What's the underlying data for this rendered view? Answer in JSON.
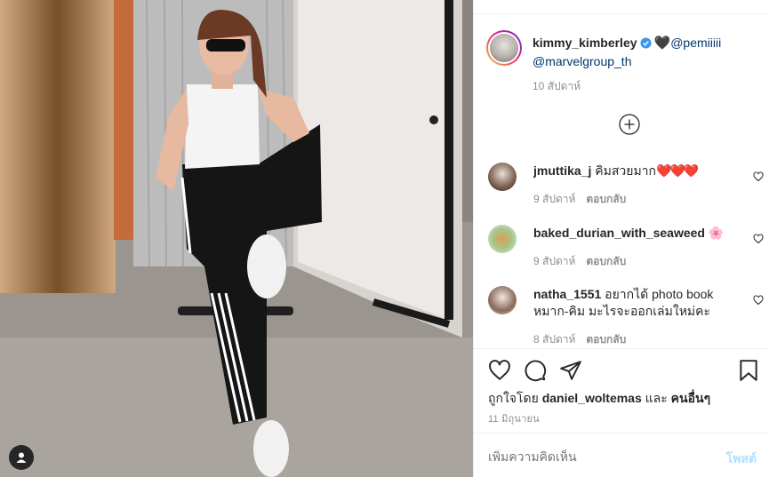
{
  "post": {
    "username": "kimmy_kimberley",
    "caption_emoji": "🖤",
    "mention_1": "@pemiiiii",
    "mention_2": "@marvelgroup_th",
    "time": "10 สัปดาห์"
  },
  "comments": [
    {
      "user": "jmuttika_j",
      "text": "คิมสวยมาก",
      "emoji": "❤️❤️❤️",
      "time": "9 สัปดาห์",
      "reply": "ตอบกลับ"
    },
    {
      "user": "baked_durian_with_seaweed",
      "text": "",
      "emoji": "🌸",
      "time": "9 สัปดาห์",
      "reply": "ตอบกลับ"
    },
    {
      "user": "natha_1551",
      "text": "อยากได้ photo book หมาก-คิม มะไรจะออกเล่มใหม่คะ",
      "emoji": "",
      "time": "8 สัปดาห์",
      "reply": "ตอบกลับ"
    }
  ],
  "likes": {
    "prefix": "ถูกใจโดย",
    "liker": "daniel_woltemas",
    "conjunction": "และ",
    "others": "คนอื่นๆ"
  },
  "date": "11 มิถุนายน",
  "add_comment": {
    "placeholder": "เพิ่มความคิดเห็น",
    "post_label": "โพสต์"
  },
  "colors": {
    "link": "#00376b",
    "verified": "#3897f0",
    "post_button_disabled": "#b2dffc",
    "muted": "#8e8e8e"
  },
  "icons": [
    "user-tag-icon",
    "verified-icon",
    "load-more-icon",
    "heart-outline-icon",
    "comment-icon",
    "share-icon",
    "bookmark-icon"
  ]
}
